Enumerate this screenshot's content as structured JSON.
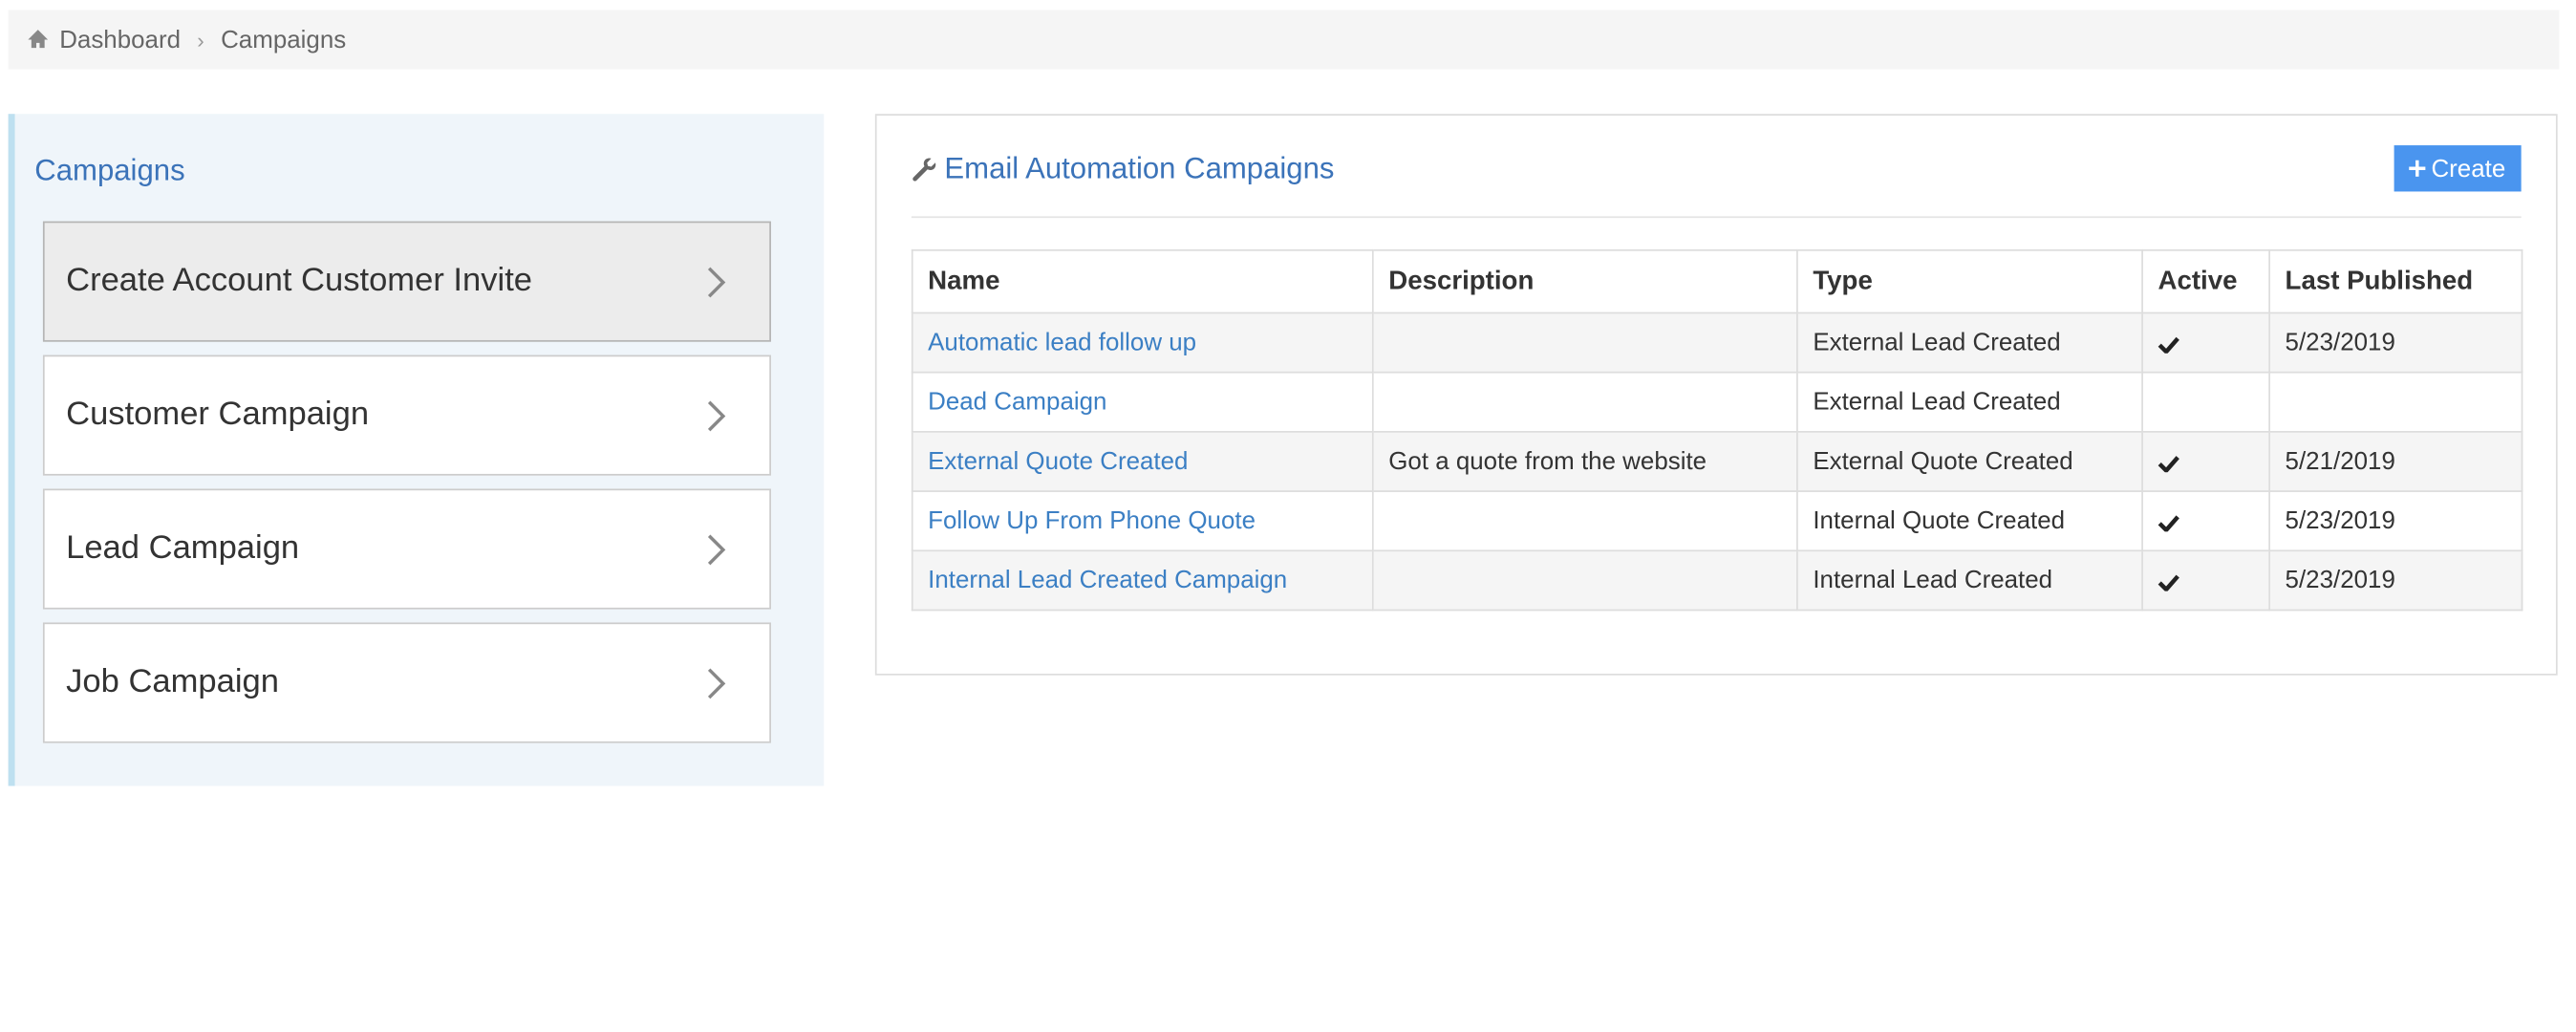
{
  "breadcrumb": {
    "home": "Dashboard",
    "current": "Campaigns"
  },
  "sidebar": {
    "title": "Campaigns",
    "items": [
      {
        "label": "Create Account Customer Invite",
        "active": true
      },
      {
        "label": "Customer Campaign",
        "active": false
      },
      {
        "label": "Lead Campaign",
        "active": false
      },
      {
        "label": "Job Campaign",
        "active": false
      }
    ]
  },
  "panel": {
    "title": "Email Automation Campaigns",
    "icon": "wrench-icon",
    "create_label": "Create",
    "create_icon": "plus-icon"
  },
  "table": {
    "columns": [
      "Name",
      "Description",
      "Type",
      "Active",
      "Last Published"
    ],
    "rows": [
      {
        "name": "Automatic lead follow up",
        "description": "",
        "type": "External Lead Created",
        "active": true,
        "last_published": "5/23/2019"
      },
      {
        "name": "Dead Campaign",
        "description": "",
        "type": "External Lead Created",
        "active": false,
        "last_published": ""
      },
      {
        "name": "External Quote Created",
        "description": "Got a quote from the website",
        "type": "External Quote Created",
        "active": true,
        "last_published": "5/21/2019"
      },
      {
        "name": "Follow Up From Phone Quote",
        "description": "",
        "type": "Internal Quote Created",
        "active": true,
        "last_published": "5/23/2019"
      },
      {
        "name": "Internal Lead Created Campaign",
        "description": "",
        "type": "Internal Lead Created",
        "active": true,
        "last_published": "5/23/2019"
      }
    ]
  },
  "colors": {
    "link": "#3b7fc4",
    "accent": "#4a95ef",
    "title": "#3b73b9",
    "sidebar_bg": "#eff5fa"
  }
}
